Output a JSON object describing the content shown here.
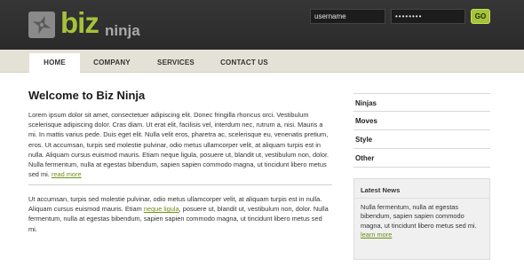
{
  "brand": {
    "name_main": "biz",
    "name_sub": "ninja",
    "accent_color": "#a6c23a"
  },
  "login": {
    "username_value": "username",
    "password_value": "••••••••",
    "go_label": "GO"
  },
  "nav": {
    "tabs": [
      {
        "label": "HOME",
        "active": true
      },
      {
        "label": "COMPANY",
        "active": false
      },
      {
        "label": "SERVICES",
        "active": false
      },
      {
        "label": "CONTACT US",
        "active": false
      }
    ]
  },
  "main": {
    "title": "Welcome to Biz Ninja",
    "paragraph1": "Lorem ipsum dolor sit amet, consectetuer adipiscing elit. Donec fringilla rhoncus orci. Vestibulum scelerisque adipiscing dolor. Cras diam. Ut erat elit, facilisis vel, interdum nec, rutrum a, nisi. Mauris a mi. In mattis varius pede. Duis eget elit. Nulla velit eros, pharetra ac, scelerisque eu, venenatis pretium, eros. Ut accumsan, turpis sed molestie pulvinar, odio metus ullamcorper velit, at aliquam turpis est in nulla. Aliquam cursus euismod mauris. Etiam neque ligula, posuere ut, blandit ut, vestibulum non, dolor. Nulla fermentum, nulla at egestas bibendum, sapien sapien commodo magna, ut tincidunt libero metus sed mi.",
    "read_more": "read more",
    "paragraph2_before": "Ut accumsan, turpis sed molestie pulvinar, odio metus ullamcorper velit, at aliquam turpis est in nulla. Aliquam cursus euismod mauris. Etiam ",
    "paragraph2_link": "neque ligula",
    "paragraph2_after": ", posuere ut, blandit ut, vestibulum non, dolor. Nulla fermentum, nulla at egestas bibendum, sapien sapien commodo magna, ut tincidunt libero metus sed mi."
  },
  "sidebar": {
    "items": [
      {
        "label": "Ninjas"
      },
      {
        "label": "Moves"
      },
      {
        "label": "Style"
      },
      {
        "label": "Other"
      }
    ],
    "news": {
      "title": "Latest News",
      "text": "Nulla fermentum, nulla at egestas bibendum, sapien sapien commodo magna, ut tincidunt libero metus sed mi.",
      "link": "learn more"
    }
  }
}
